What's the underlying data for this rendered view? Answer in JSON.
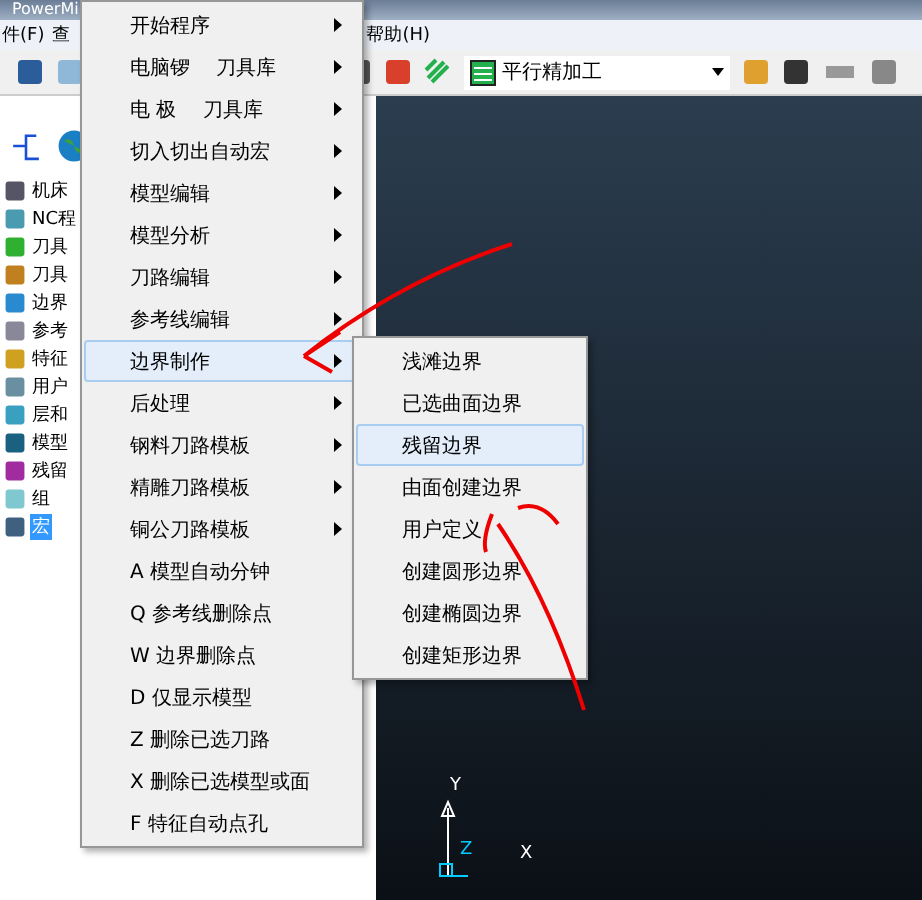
{
  "window": {
    "title": "PowerMi"
  },
  "menubar": [
    "件(F)",
    "查",
    "帮助(H)"
  ],
  "toolbar": {
    "strategy": "平行精加工"
  },
  "explorer": {
    "items": [
      {
        "label": "机床",
        "selected": false
      },
      {
        "label": "NC程",
        "selected": false
      },
      {
        "label": "刀具",
        "selected": false
      },
      {
        "label": "刀具",
        "selected": false
      },
      {
        "label": "边界",
        "selected": false
      },
      {
        "label": "参考",
        "selected": false
      },
      {
        "label": "特征",
        "selected": false
      },
      {
        "label": "用户",
        "selected": false
      },
      {
        "label": "层和",
        "selected": false
      },
      {
        "label": "模型",
        "selected": false
      },
      {
        "label": "残留",
        "selected": false
      },
      {
        "label": "组",
        "selected": false
      },
      {
        "label": "宏",
        "selected": true
      }
    ]
  },
  "context_menu": {
    "items": [
      {
        "label": "开始程序",
        "has_submenu": true,
        "selected": false
      },
      {
        "label": "电脑锣　 刀具库",
        "has_submenu": true,
        "selected": false
      },
      {
        "label": "电 极　 刀具库",
        "has_submenu": true,
        "selected": false
      },
      {
        "label": "切入切出自动宏",
        "has_submenu": true,
        "selected": false
      },
      {
        "label": "模型编辑",
        "has_submenu": true,
        "selected": false
      },
      {
        "label": "模型分析",
        "has_submenu": true,
        "selected": false
      },
      {
        "label": "刀路编辑",
        "has_submenu": true,
        "selected": false
      },
      {
        "label": "参考线编辑",
        "has_submenu": true,
        "selected": false
      },
      {
        "label": "边界制作",
        "has_submenu": true,
        "selected": true
      },
      {
        "label": "后处理",
        "has_submenu": true,
        "selected": false
      },
      {
        "label": "钢料刀路模板",
        "has_submenu": true,
        "selected": false
      },
      {
        "label": "精雕刀路模板",
        "has_submenu": true,
        "selected": false
      },
      {
        "label": "铜公刀路模板",
        "has_submenu": true,
        "selected": false
      },
      {
        "label": "A 模型自动分钟",
        "has_submenu": false,
        "selected": false
      },
      {
        "label": "Q 参考线删除点",
        "has_submenu": false,
        "selected": false
      },
      {
        "label": "W 边界删除点",
        "has_submenu": false,
        "selected": false
      },
      {
        "label": "D 仅显示模型",
        "has_submenu": false,
        "selected": false
      },
      {
        "label": "Z 删除已选刀路",
        "has_submenu": false,
        "selected": false
      },
      {
        "label": "X 删除已选模型或面",
        "has_submenu": false,
        "selected": false
      },
      {
        "label": "F 特征自动点孔",
        "has_submenu": false,
        "selected": false
      }
    ]
  },
  "submenu": {
    "items": [
      {
        "label": "浅滩边界",
        "selected": false
      },
      {
        "label": "已选曲面边界",
        "selected": false
      },
      {
        "label": "残留边界",
        "selected": true
      },
      {
        "label": "由面创建边界",
        "selected": false
      },
      {
        "label": "用户定义",
        "selected": false
      },
      {
        "label": "创建圆形边界",
        "selected": false
      },
      {
        "label": "创建椭圆边界",
        "selected": false
      },
      {
        "label": "创建矩形边界",
        "selected": false
      }
    ]
  },
  "viewport": {
    "axes": {
      "y": "Y",
      "z": "Z",
      "x": "X"
    }
  }
}
